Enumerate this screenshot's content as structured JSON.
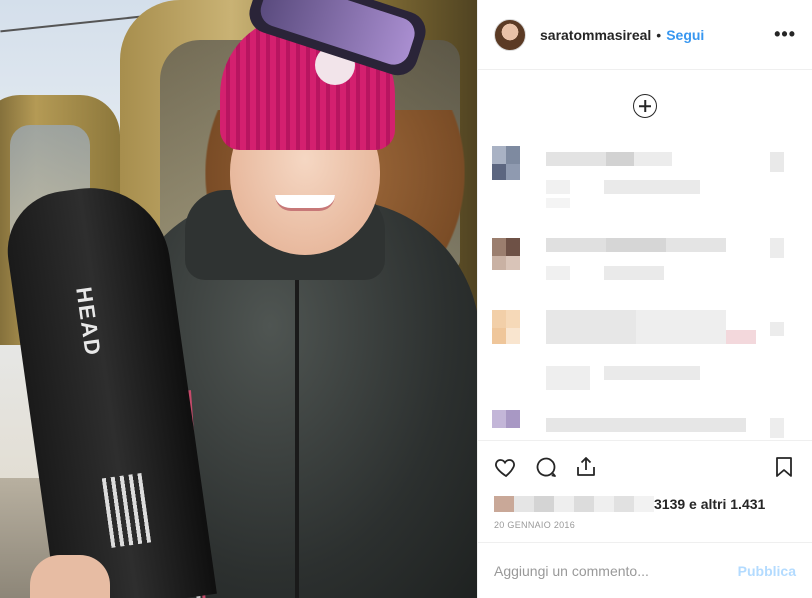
{
  "post": {
    "username": "saratommasireal",
    "separator": "•",
    "follow_label": "Segui",
    "more_icon": "•••",
    "ski_brand": "HEAD"
  },
  "likes": {
    "text": "3139 e altri 1.431"
  },
  "date": "20 GENNAIO 2016",
  "comment_box": {
    "placeholder": "Aggiungi un commento...",
    "publish_label": "Pubblica"
  },
  "colors": {
    "link_blue": "#3897f0",
    "publish_disabled": "#b3dbff",
    "hat_pink": "#d4206f"
  }
}
